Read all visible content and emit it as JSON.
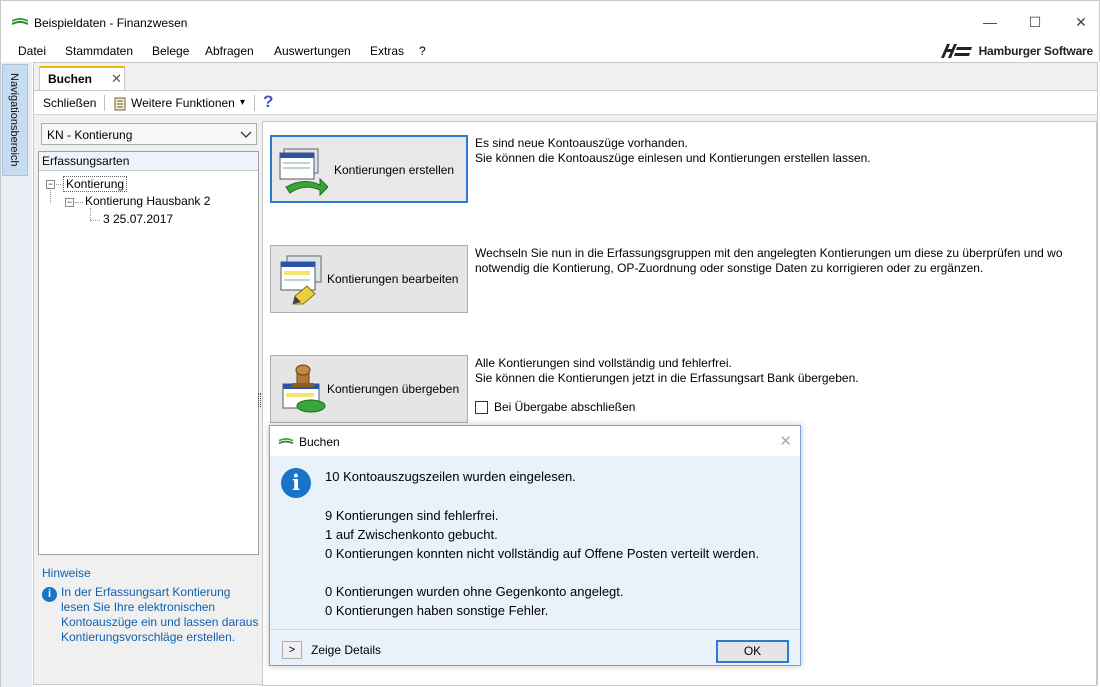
{
  "window": {
    "title": "Beispieldaten - Finanzwesen",
    "minimize": "—",
    "maximize": "☐",
    "close": "✕"
  },
  "menu": {
    "items": [
      "Datei",
      "Stammdaten",
      "Belege",
      "Abfragen",
      "Auswertungen",
      "Extras",
      "?"
    ],
    "brand": "Hamburger Software"
  },
  "nav": {
    "label": "Navigationsbereich"
  },
  "tab": {
    "label": "Buchen",
    "close": "✕"
  },
  "toolbar": {
    "close_label": "Schließen",
    "more_label": "Weitere Funktionen",
    "dropdown": "▾",
    "help": "?"
  },
  "left": {
    "combo_value": "KN - Kontierung",
    "tree_header": "Erfassungsarten",
    "tree": {
      "root": "Kontierung",
      "child": "Kontierung Hausbank 2",
      "leaf": "3 25.07.2017"
    },
    "hints_header": "Hinweise",
    "hints_text": "In der Erfassungsart Kontierung lesen Sie Ihre elektronischen Kontoauszüge ein und lassen daraus Kontierungsvorschläge erstellen."
  },
  "actions": [
    {
      "label": "Kontierungen erstellen",
      "desc1": "Es sind neue Kontoauszüge vorhanden.",
      "desc2": "Sie können die Kontoauszüge einlesen und Kontierungen erstellen lassen."
    },
    {
      "label": "Kontierungen bearbeiten",
      "desc1": "Wechseln Sie nun in die Erfassungsgruppen mit den angelegten Kontierungen um diese zu überprüfen und wo",
      "desc2": "notwendig die Kontierung, OP-Zuordnung oder sonstige Daten zu korrigieren oder zu ergänzen."
    },
    {
      "label": "Kontierungen übergeben",
      "desc1": "Alle Kontierungen sind vollständig und fehlerfrei.",
      "desc2": "Sie können die Kontierungen jetzt in die Erfassungsart Bank übergeben."
    }
  ],
  "checkbox": {
    "label": "Bei Übergabe abschließen"
  },
  "dialog": {
    "title": "Buchen",
    "close": "✕",
    "headline": "10 Kontoauszugszeilen wurden eingelesen.",
    "lines": [
      "9 Kontierungen sind fehlerfrei.",
      "1 auf Zwischenkonto gebucht.",
      "0 Kontierungen konnten nicht vollständig auf Offene Posten verteilt werden.",
      "0 Kontierungen wurden ohne Gegenkonto angelegt.",
      "0 Kontierungen haben sonstige Fehler."
    ],
    "details_arrow": ">",
    "details_label": "Zeige Details",
    "ok_label": "OK"
  }
}
